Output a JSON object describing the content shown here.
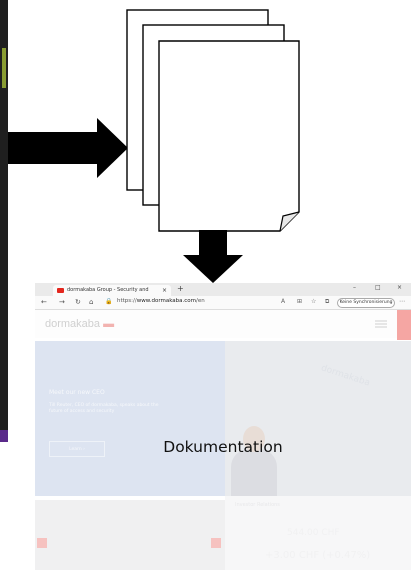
{
  "diagram": {
    "label": "Dokumentation"
  },
  "browser": {
    "tab_title": "dormakaba Group - Security and",
    "tab_close": "×",
    "new_tab": "+",
    "url_prefix": "https://",
    "url_main": "www.dormakaba.com",
    "url_suffix": "/en",
    "sync_label": "Keine Synchronisierung",
    "win_min": "–",
    "win_max": "□",
    "win_close": "×"
  },
  "website": {
    "logo_main": "dormakaba",
    "logo_mark": "▬",
    "hero_title": "Meet our new CEO",
    "hero_text": "Till Reuter, CEO of dormakaba, speaks about the future of access and security",
    "hero_button": "Learn  ›",
    "building_text": "dormakaba",
    "investor_title": "Investor Relations",
    "share_price": "544.00 CHF",
    "share_change": "+3.00 CHF (+0.47%)"
  },
  "colors": {
    "brand_red": "#e3261d",
    "hero_blue": "#dde4f1"
  }
}
